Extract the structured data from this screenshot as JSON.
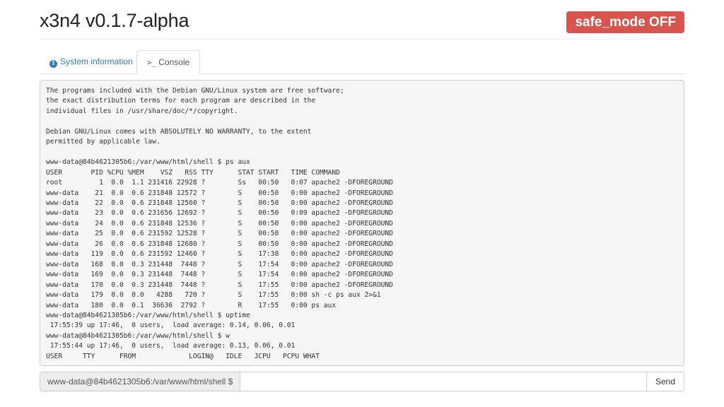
{
  "header": {
    "title": "x3n4 v0.1.7-alpha",
    "safe_mode_badge": "safe_mode OFF",
    "badge_color": "#d9534f"
  },
  "tabs": [
    {
      "label": "System information",
      "icon": "info-icon",
      "active": false
    },
    {
      "label": "Console",
      "icon": "terminal-prompt-icon",
      "active": true
    }
  ],
  "console": {
    "output": "The programs included with the Debian GNU/Linux system are free software;\nthe exact distribution terms for each program are described in the\nindividual files in /usr/share/doc/*/copyright.\n\nDebian GNU/Linux comes with ABSOLUTELY NO WARRANTY, to the extent\npermitted by applicable law.\n\nwww-data@84b4621305b6:/var/www/html/shell $ ps aux\nUSER       PID %CPU %MEM    VSZ   RSS TTY      STAT START   TIME COMMAND\nroot         1  0.0  1.1 231416 22928 ?        Ss   00:50   0:07 apache2 -DFOREGROUND\nwww-data    21  0.0  0.6 231848 12572 ?        S    00:50   0:00 apache2 -DFOREGROUND\nwww-data    22  0.0  0.6 231848 12560 ?        S    00:50   0:00 apache2 -DFOREGROUND\nwww-data    23  0.0  0.6 231656 12692 ?        S    00:50   0:09 apache2 -DFOREGROUND\nwww-data    24  0.0  0.6 231848 12536 ?        S    00:50   0:00 apache2 -DFOREGROUND\nwww-data    25  0.0  0.6 231592 12528 ?        S    00:50   0:00 apache2 -DFOREGROUND\nwww-data    26  0.0  0.6 231848 12680 ?        S    00:50   0:00 apache2 -DFOREGROUND\nwww-data   119  0.0  0.6 231592 12460 ?        S    17:38   0:00 apache2 -DFOREGROUND\nwww-data   168  0.0  0.3 231448  7448 ?        S    17:54   0:00 apache2 -DFOREGROUND\nwww-data   169  0.0  0.3 231448  7448 ?        S    17:54   0:00 apache2 -DFOREGROUND\nwww-data   170  0.0  0.3 231448  7448 ?        S    17:55   0:00 apache2 -DFOREGROUND\nwww-data   179  0.0  0.0   4288   720 ?        S    17:55   0:00 sh -c ps aux 2>&1\nwww-data   180  0.0  0.1  36636  2792 ?        R    17:55   0:00 ps aux\nwww-data@84b4621305b6:/var/www/html/shell $ uptime\n 17:55:39 up 17:46,  0 users,  load average: 0.14, 0.06, 0.01\nwww-data@84b4621305b6:/var/www/html/shell $ w\n 17:55:44 up 17:46,  0 users,  load average: 0.13, 0.06, 0.01\nUSER     TTY      FROM             LOGIN@   IDLE   JCPU   PCPU WHAT"
  },
  "command": {
    "prompt": "www-data@84b4621305b6:/var/www/html/shell $",
    "value": "",
    "send_label": "Send"
  }
}
